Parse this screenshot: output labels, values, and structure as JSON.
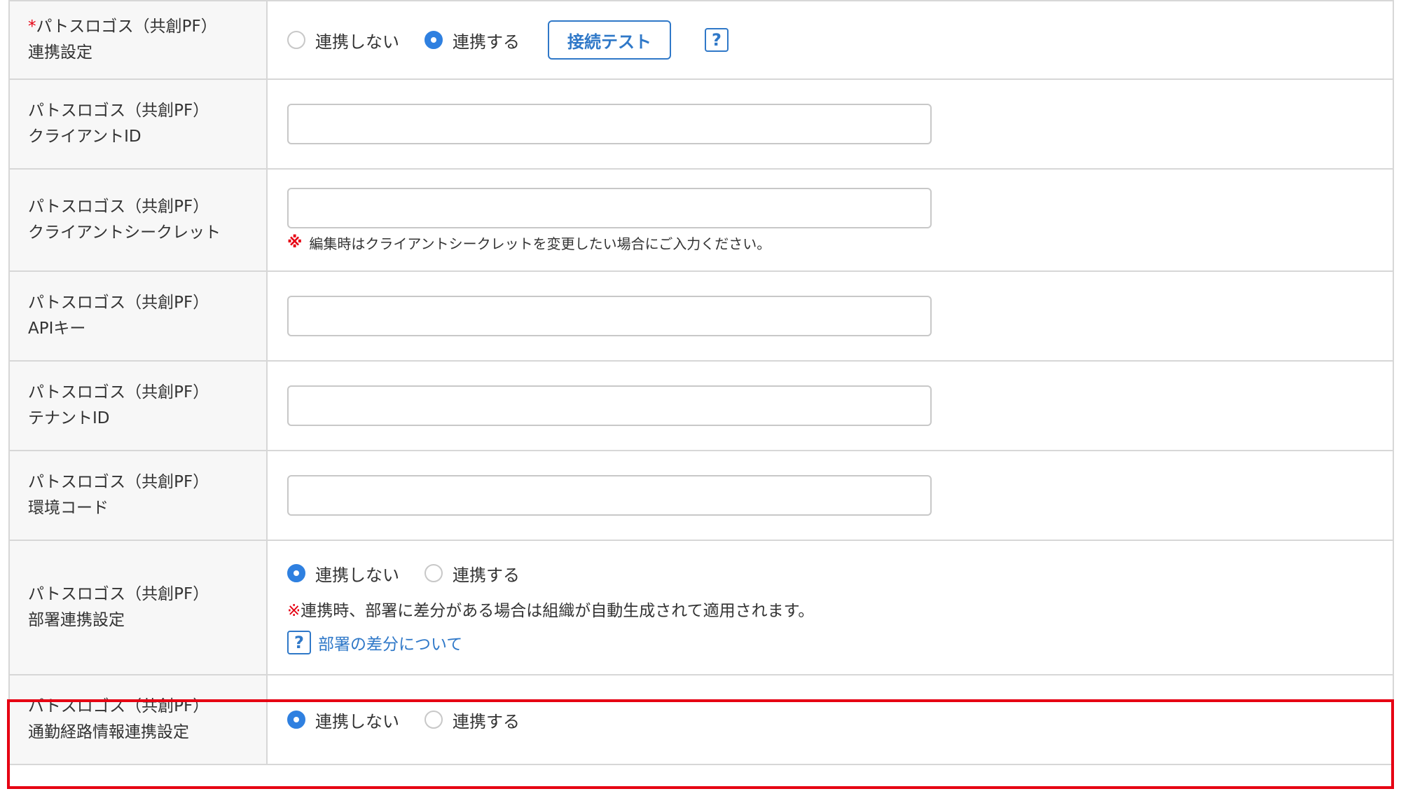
{
  "rows": [
    {
      "label_req": "*",
      "label_line1": "パトスロゴス（共創PF）",
      "label_line2": "連携設定"
    },
    {
      "label_line1": "パトスロゴス（共創PF）",
      "label_line2": "クライアントID"
    },
    {
      "label_line1": "パトスロゴス（共創PF）",
      "label_line2": "クライアントシークレット"
    },
    {
      "label_line1": "パトスロゴス（共創PF）",
      "label_line2": "APIキー"
    },
    {
      "label_line1": "パトスロゴス（共創PF）",
      "label_line2": "テナントID"
    },
    {
      "label_line1": "パトスロゴス（共創PF）",
      "label_line2": "環境コード"
    },
    {
      "label_line1": "パトスロゴス（共創PF）",
      "label_line2": "部署連携設定"
    },
    {
      "label_line1": "パトスロゴス（共創PF）",
      "label_line2": "通勤経路情報連携設定"
    }
  ],
  "options": {
    "no": "連携しない",
    "yes": "連携する"
  },
  "connection_test_label": "接続テスト",
  "help_icon_text": "?",
  "note_mark": "※",
  "secret_note": "編集時はクライアントシークレットを変更したい場合にご入力ください。",
  "dept_note": "連携時、部署に差分がある場合は組織が自動生成されて適用されます。",
  "dept_help_link": "部署の差分について",
  "selections": {
    "link_setting": "連携する",
    "dept_link_setting": "連携しない",
    "commute_link_setting": "連携しない"
  },
  "colors": {
    "accent": "#2f80e0",
    "required": "#e60012",
    "highlight_border": "#e60012",
    "link": "#2f78c8"
  }
}
